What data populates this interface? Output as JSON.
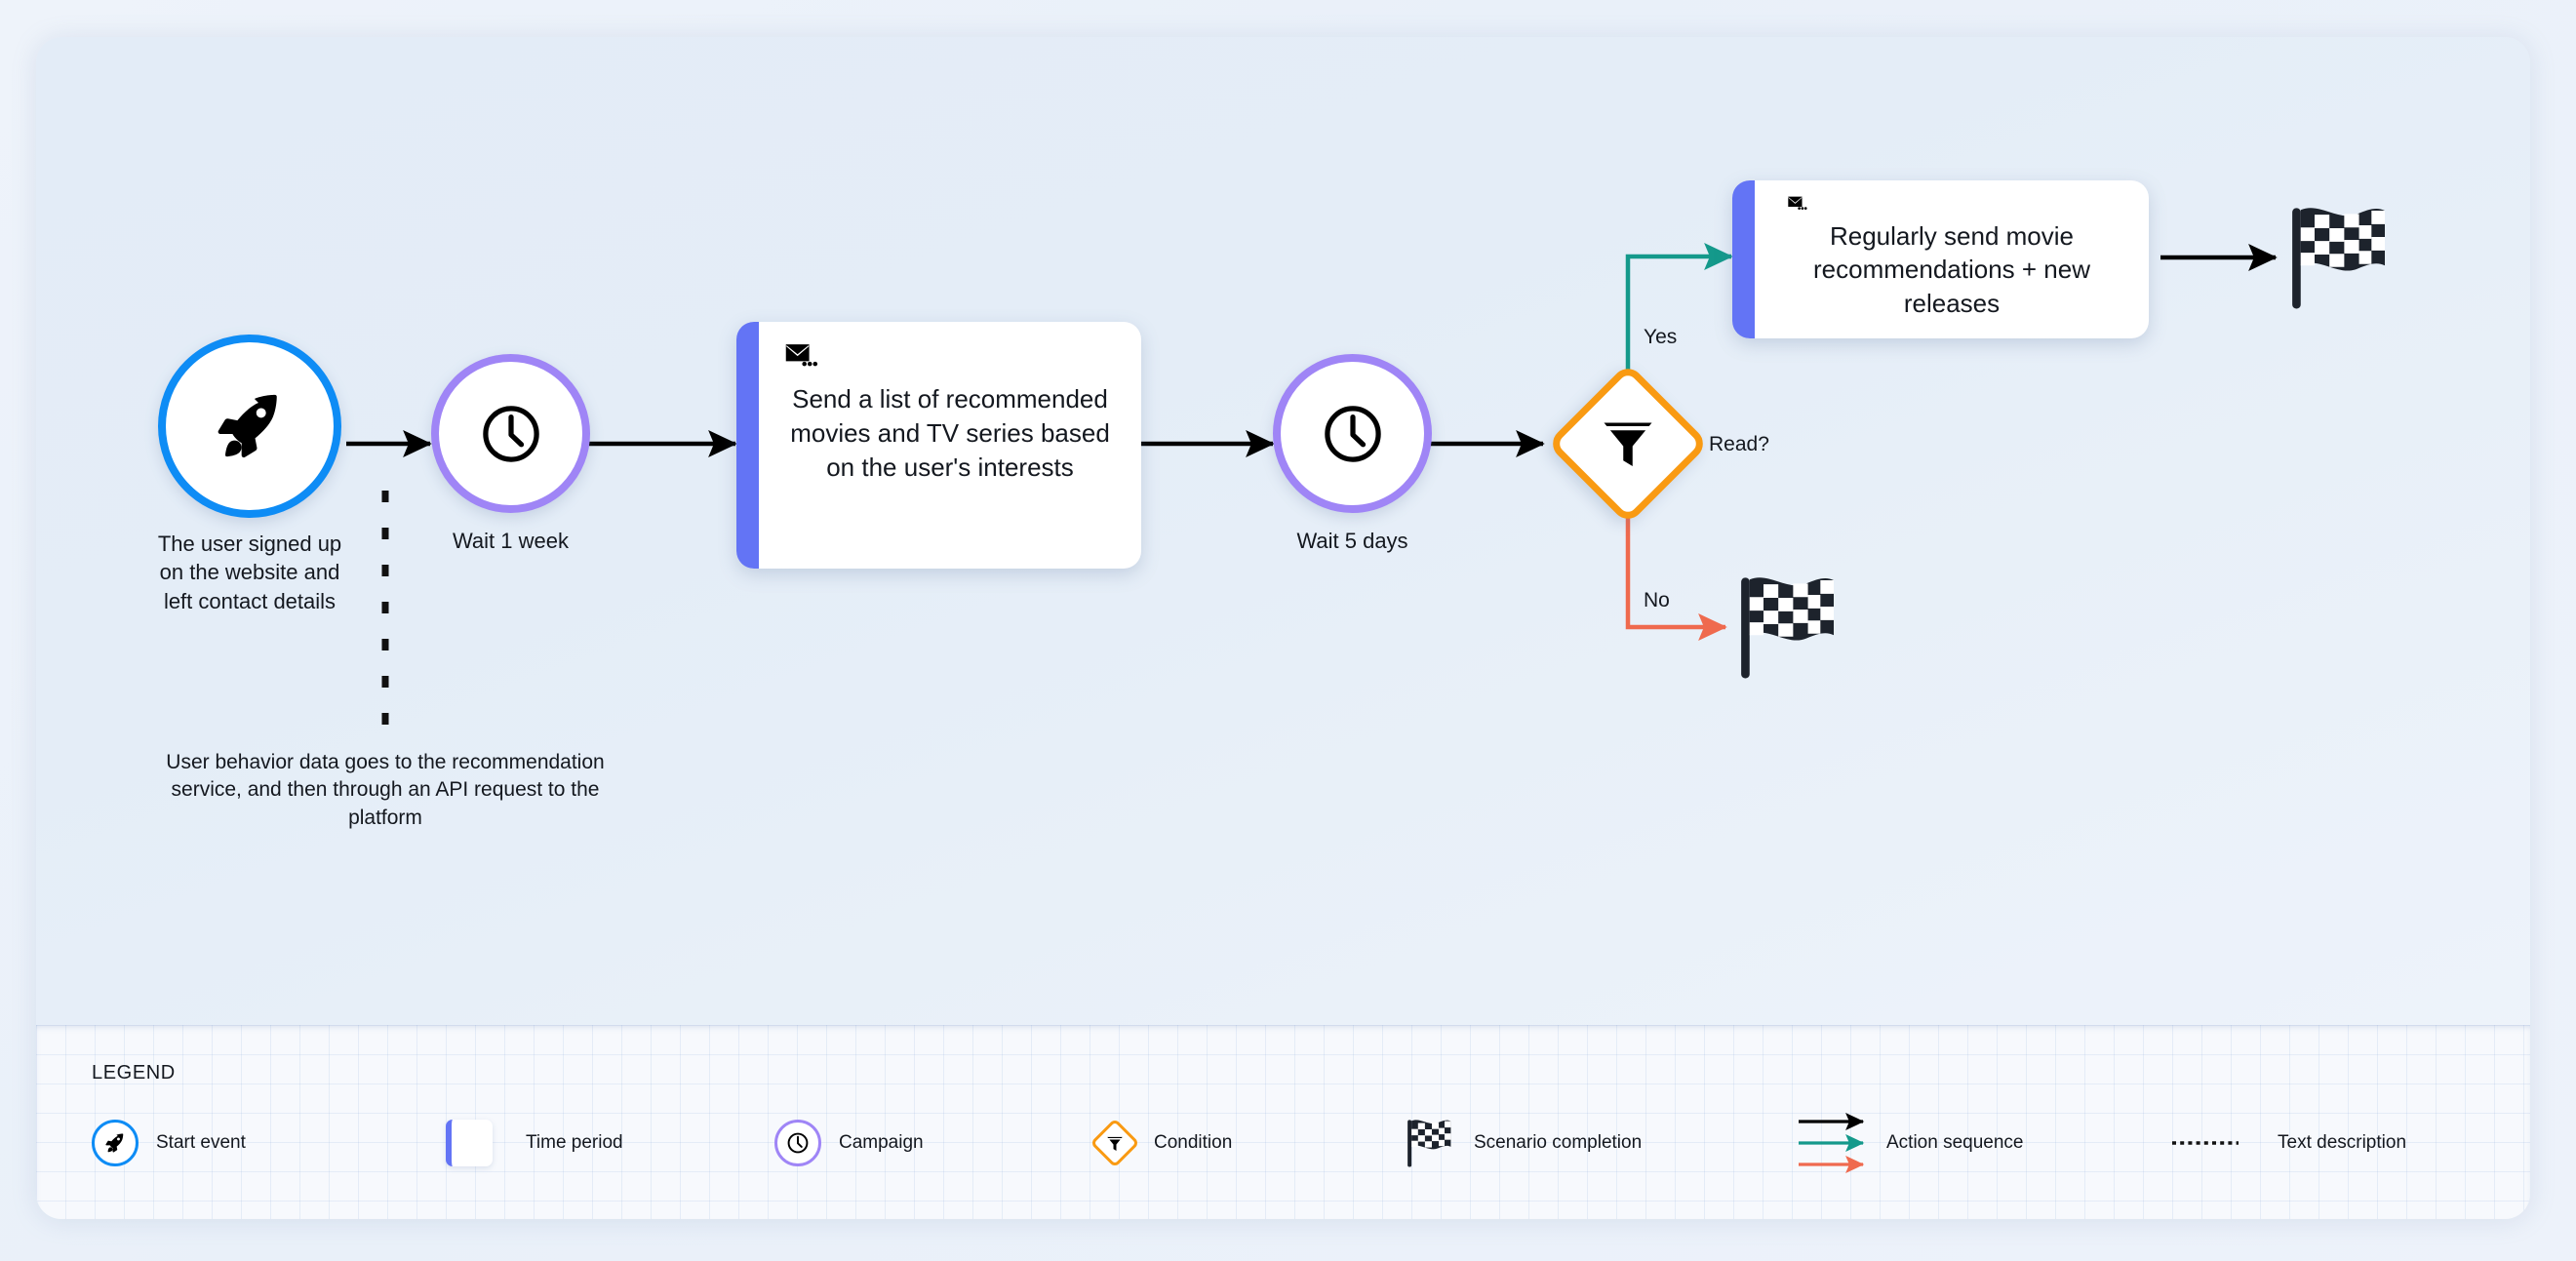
{
  "colors": {
    "start_ring": "#0e8cf5",
    "wait_ring": "#9f85f6",
    "card_accent": "#6374f5",
    "condition_border": "#f99a12",
    "yes_edge": "#14998b",
    "no_edge": "#ef6a4e",
    "default_edge": "#000000",
    "canvas_bg": "#e6eef8",
    "legend_bg": "#f7f9fd"
  },
  "flow": {
    "start": {
      "icon": "rocket-icon",
      "caption": "The user signed up\non the website and\nleft contact details"
    },
    "wait_1": {
      "icon": "clock-icon",
      "caption": "Wait 1 week"
    },
    "email_1": {
      "icon": "envelope-icon",
      "text": "Send a list of recommended movies and TV series based on the user's interests"
    },
    "wait_2": {
      "icon": "clock-icon",
      "caption": "Wait 5 days"
    },
    "condition": {
      "icon": "funnel-icon",
      "label": "Read?",
      "yes_label": "Yes",
      "no_label": "No"
    },
    "email_2": {
      "icon": "envelope-icon",
      "text": "Regularly send movie recommendations + new releases"
    },
    "end_top": {
      "icon": "checkered-flag-icon"
    },
    "end_bottom": {
      "icon": "checkered-flag-icon"
    },
    "note": "User behavior data goes to the recommendation\nservice, and then through an API request to the\nplatform"
  },
  "legend": {
    "title": "LEGEND",
    "items": [
      {
        "label": "Start event",
        "icon": "rocket-icon"
      },
      {
        "label": "Time period",
        "icon": "card-accent-icon"
      },
      {
        "label": "Campaign",
        "icon": "clock-icon"
      },
      {
        "label": "Condition",
        "icon": "funnel-icon"
      },
      {
        "label": "Scenario completion",
        "icon": "checkered-flag-icon"
      },
      {
        "label": "Action sequence",
        "icon": "arrows-icon"
      },
      {
        "label": "Text description",
        "icon": "dotted-line-icon"
      }
    ]
  }
}
